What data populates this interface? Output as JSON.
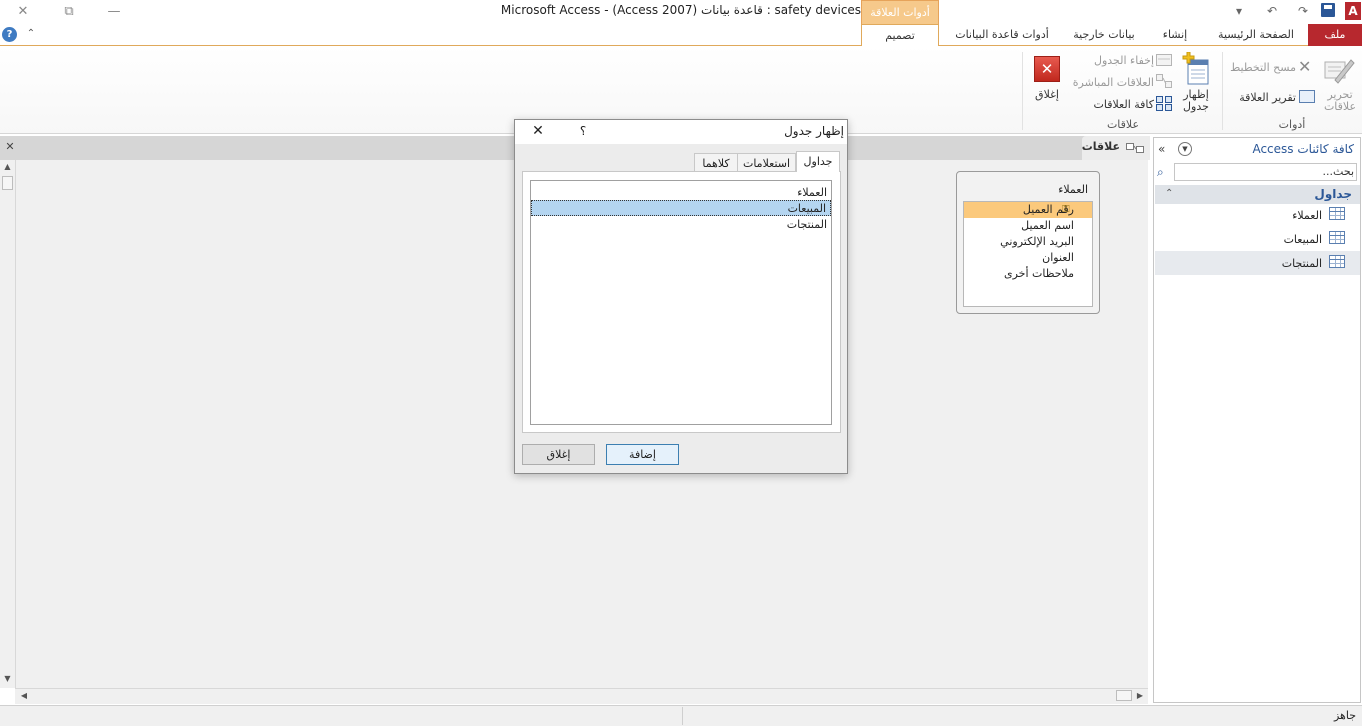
{
  "window": {
    "title": "Microsoft Access - (Access 2007) قاعدة بيانات : safety devices",
    "minimize_glyph": "—",
    "restore_glyph": "⧉",
    "close_glyph": "✕"
  },
  "quick_access": {
    "app_letter": "A",
    "undo_glyph": "↶",
    "redo_glyph": "↷",
    "customize_glyph": "▾"
  },
  "contextual_tab_group": "أدوات العلاقة",
  "ribbon_tabs": {
    "file": "ملف",
    "home": "الصفحة الرئيسية",
    "create": "إنشاء",
    "external_data": "بيانات خارجية",
    "database_tools": "أدوات قاعدة البيانات",
    "design": "تصميم"
  },
  "ribbon": {
    "tools_group": {
      "caption": "أدوات",
      "edit_relationships": [
        "تحرير",
        "علاقات"
      ],
      "clear_layout": "مسح التخطيط",
      "relationship_report": "تقرير العلاقة"
    },
    "relationships_group": {
      "caption": "علاقات",
      "show_table": [
        "إظهار",
        "جدول"
      ],
      "hide_table": "إخفاء الجدول",
      "direct_relationships": "العلاقات المباشرة",
      "all_relationships": "كافة العلاقات",
      "close": "إغلاق"
    }
  },
  "document_tab": {
    "label": "علاقات",
    "close_glyph": "✕"
  },
  "nav_pane": {
    "title": "كافة كائنات Access",
    "search_placeholder": "بحث...",
    "group": "جداول",
    "items": [
      "العملاء",
      "المبيعات",
      "المنتجات"
    ]
  },
  "field_list": {
    "table_name": "العملاء",
    "fields": [
      "رقم العميل",
      "اسم العميل",
      "البريد الإلكتروني",
      "العنوان",
      "ملاحظات أخرى"
    ],
    "primary_key_index": 0,
    "highlight_color": "#fbc97c"
  },
  "dialog": {
    "title": "إظهار جدول",
    "help": "؟",
    "close_glyph": "✕",
    "tabs": [
      "جداول",
      "استعلامات",
      "كلاهما"
    ],
    "items": [
      "العملاء",
      "المبيعات",
      "المنتجات"
    ],
    "selected_index": 1,
    "add_button": "إضافة",
    "close_button": "إغلاق"
  },
  "status": {
    "text": "جاهز"
  },
  "colors": {
    "file_tab": "#b7282e",
    "contextual": "#f6c98b",
    "selection": "#b4d5f0",
    "accent_blue": "#2b5797"
  }
}
